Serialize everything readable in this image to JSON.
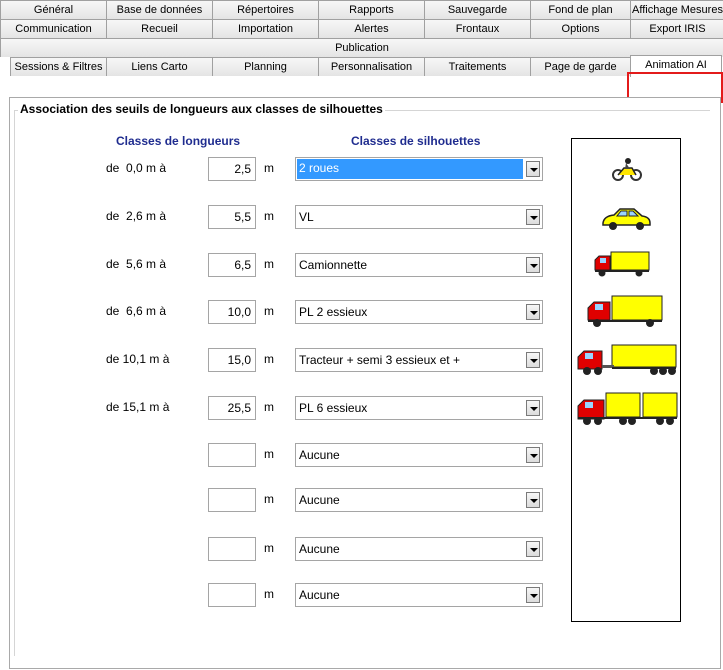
{
  "tabs": {
    "row1": [
      "Général",
      "Base de données",
      "Répertoires",
      "Rapports",
      "Sauvegarde",
      "Fond de plan",
      "Affichage Mesures"
    ],
    "row2": [
      "Communication",
      "Recueil",
      "Importation",
      "Alertes",
      "Frontaux",
      "Options",
      "Export IRIS"
    ],
    "row3": [
      "Publication"
    ],
    "row4": [
      "Sessions & Filtres",
      "Liens Carto",
      "Planning",
      "Personnalisation",
      "Traitements",
      "Page de garde",
      "Animation AI"
    ],
    "active": "Animation AI"
  },
  "group_title": "Association des seuils de longueurs aux classes de silhouettes",
  "headers": {
    "lengths": "Classes de longueurs",
    "silhouettes": "Classes de silhouettes"
  },
  "unit": "m",
  "rows": [
    {
      "from": "de  0,0 m à",
      "to": "2,5",
      "class": "2 roues",
      "icon": "motorcycle-icon"
    },
    {
      "from": "de  2,6 m à",
      "to": "5,5",
      "class": "VL",
      "icon": "car-icon"
    },
    {
      "from": "de  5,6 m à",
      "to": "6,5",
      "class": "Camionnette",
      "icon": "van-icon"
    },
    {
      "from": "de  6,6 m à",
      "to": "10,0",
      "class": "PL 2 essieux",
      "icon": "truck-2-axles-icon"
    },
    {
      "from": "de 10,1 m à",
      "to": "15,0",
      "class": "Tracteur + semi 3 essieux et +",
      "icon": "semi-trailer-icon"
    },
    {
      "from": "de 15,1 m à",
      "to": "25,5",
      "class": "PL 6 essieux",
      "icon": "truck-6-axles-icon"
    },
    {
      "from": "",
      "to": "",
      "class": "Aucune",
      "icon": ""
    },
    {
      "from": "",
      "to": "",
      "class": "Aucune",
      "icon": ""
    },
    {
      "from": "",
      "to": "",
      "class": "Aucune",
      "icon": ""
    },
    {
      "from": "",
      "to": "",
      "class": "Aucune",
      "icon": ""
    }
  ],
  "colors": {
    "highlight": "#e31b1b",
    "header_text": "#1f2c8f",
    "selection": "#3399ff",
    "vehicle_yellow": "#ffff00",
    "vehicle_red": "#e00000"
  }
}
